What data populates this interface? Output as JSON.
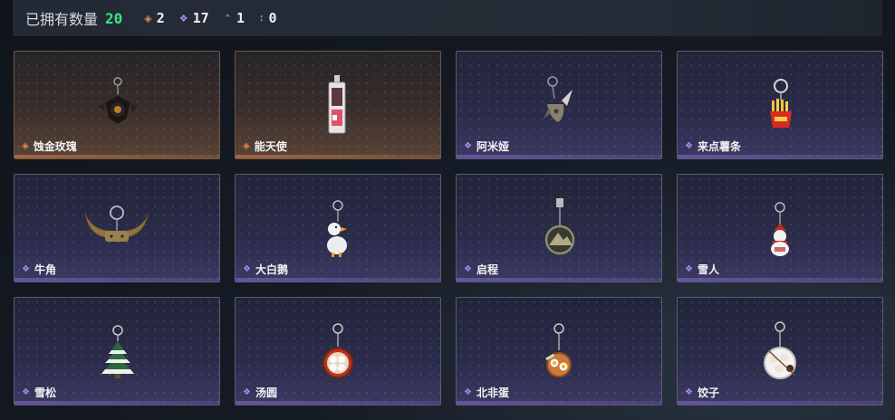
{
  "header": {
    "owned_label": "已拥有数量",
    "owned_count": "20",
    "stats": [
      {
        "icon": "orange-diamond-icon",
        "color": "#e08a4a",
        "value": "2"
      },
      {
        "icon": "purple-diamond-icon",
        "color": "#a98ef0",
        "value": "17"
      },
      {
        "icon": "blue-chevron-icon",
        "color": "#5fb0ff",
        "value": "1"
      },
      {
        "icon": "teal-arrows-icon",
        "color": "#4fd6c2",
        "value": "0"
      }
    ]
  },
  "items": [
    {
      "name": "蚀金玫瑰",
      "rarity": "orange",
      "icon": "black-rose-charm-icon"
    },
    {
      "name": "能天使",
      "rarity": "orange",
      "icon": "angel-card-charm-icon"
    },
    {
      "name": "阿米娅",
      "rarity": "purple",
      "icon": "bunny-ears-charm-icon"
    },
    {
      "name": "来点薯条",
      "rarity": "purple",
      "icon": "french-fries-charm-icon"
    },
    {
      "name": "牛角",
      "rarity": "purple",
      "icon": "bull-horns-charm-icon"
    },
    {
      "name": "大白鹅",
      "rarity": "purple",
      "icon": "white-goose-charm-icon"
    },
    {
      "name": "启程",
      "rarity": "purple",
      "icon": "mountain-medallion-charm-icon"
    },
    {
      "name": "雪人",
      "rarity": "purple",
      "icon": "snowman-charm-icon"
    },
    {
      "name": "雪松",
      "rarity": "purple",
      "icon": "snowy-pine-charm-icon"
    },
    {
      "name": "汤圆",
      "rarity": "purple",
      "icon": "rice-ball-bowl-charm-icon"
    },
    {
      "name": "北非蛋",
      "rarity": "purple",
      "icon": "shakshuka-charm-icon"
    },
    {
      "name": "饺子",
      "rarity": "purple",
      "icon": "dumplings-plate-charm-icon"
    }
  ]
}
